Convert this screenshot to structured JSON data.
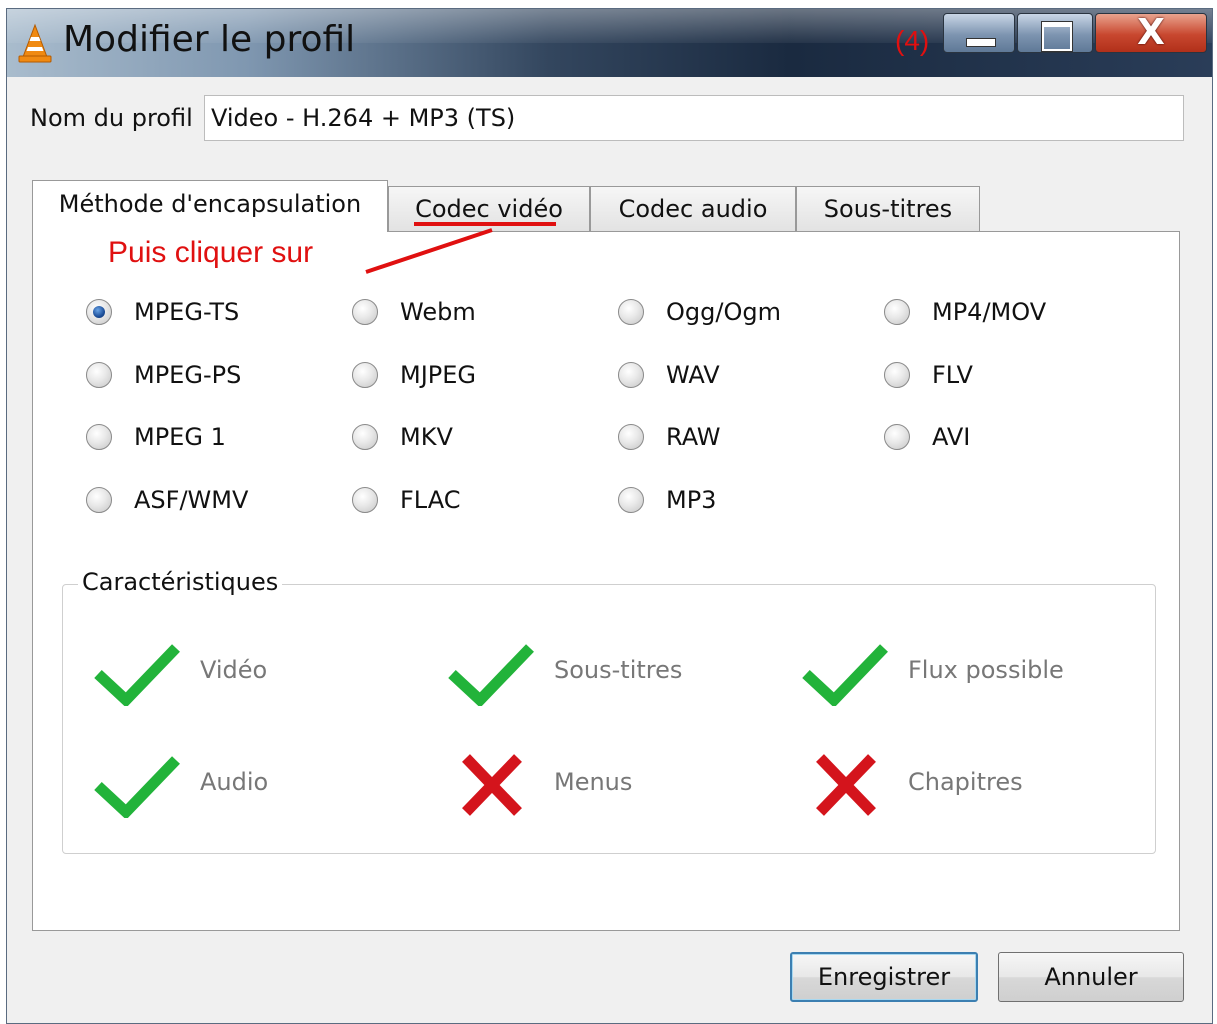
{
  "window": {
    "title": "Modifier le profil",
    "annotation_step": "(4)",
    "close_glyph": "X"
  },
  "profile": {
    "name_label": "Nom du profil",
    "name_value": "Video - H.264 + MP3 (TS)"
  },
  "tabs": [
    {
      "label": "Méthode d'encapsulation",
      "active": true
    },
    {
      "label": "Codec vidéo",
      "active": false
    },
    {
      "label": "Codec audio",
      "active": false
    },
    {
      "label": "Sous-titres",
      "active": false
    }
  ],
  "annotation": {
    "text": "Puis cliquer sur",
    "color": "#e01010"
  },
  "encapsulation": {
    "options": [
      "MPEG-TS",
      "Webm",
      "Ogg/Ogm",
      "MP4/MOV",
      "MPEG-PS",
      "MJPEG",
      "WAV",
      "FLV",
      "MPEG 1",
      "MKV",
      "RAW",
      "AVI",
      "ASF/WMV",
      "FLAC",
      "MP3"
    ],
    "selected": "MPEG-TS"
  },
  "features": {
    "title": "Caractéristiques",
    "items": [
      {
        "label": "Vidéo",
        "supported": true
      },
      {
        "label": "Sous-titres",
        "supported": true
      },
      {
        "label": "Flux possible",
        "supported": true
      },
      {
        "label": "Audio",
        "supported": true
      },
      {
        "label": "Menus",
        "supported": false
      },
      {
        "label": "Chapitres",
        "supported": false
      }
    ],
    "check_color": "#22b33a",
    "cross_color": "#d4141c"
  },
  "buttons": {
    "save_label": "Enregistrer",
    "cancel_label": "Annuler"
  }
}
